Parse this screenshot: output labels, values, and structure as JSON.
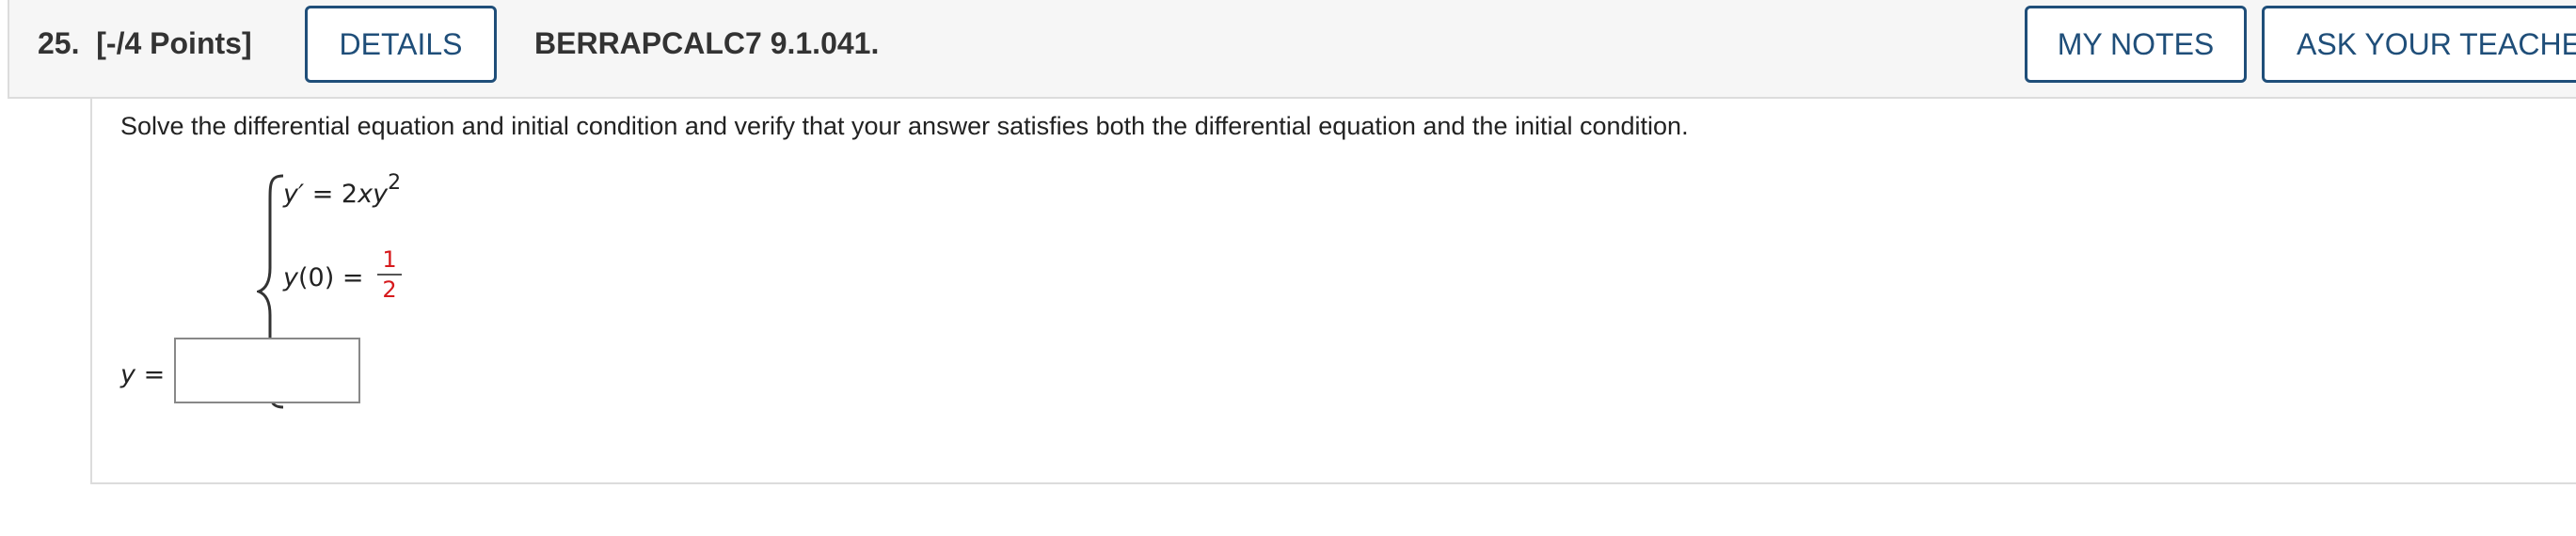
{
  "header": {
    "question_number": "25.",
    "points": "[-/4 Points]",
    "details_label": "DETAILS",
    "source": "BERRAPCALC7 9.1.041.",
    "my_notes_label": "MY NOTES",
    "ask_teacher_label": "ASK YOUR TEACHER"
  },
  "problem": {
    "instructions": "Solve the differential equation and initial condition and verify that your answer satisfies both the differential equation and the initial condition.",
    "equation1": {
      "lhs": "y′",
      "equals": "=",
      "coef": "2",
      "var_x": "x",
      "var_y": "y",
      "exponent": "2"
    },
    "equation2": {
      "lhs_var": "y",
      "lhs_arg": "(0)",
      "equals": "=",
      "numerator": "1",
      "denominator": "2"
    },
    "answer_label_var": "y",
    "answer_label_eq": "=",
    "answer_value": ""
  },
  "colors": {
    "button_border": "#1f4e79",
    "fraction_red": "#d6191c",
    "header_bg": "#f6f6f6"
  }
}
